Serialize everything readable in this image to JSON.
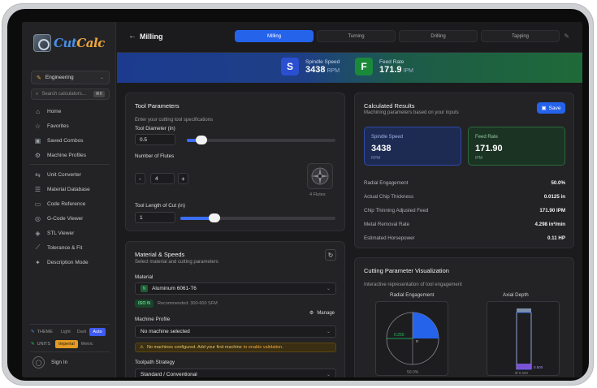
{
  "app": {
    "logo_cut": "Cut",
    "logo_calc": "Calc"
  },
  "sidebar": {
    "category": "Engineering",
    "search_placeholder": "Search calculators...",
    "search_shortcut": "⌘K",
    "items": [
      {
        "label": "Home",
        "icon": "home-icon",
        "glyph": "⌂"
      },
      {
        "label": "Favorites",
        "icon": "star-icon",
        "glyph": "☆"
      },
      {
        "label": "Saved Combos",
        "icon": "save-icon",
        "glyph": "▣"
      },
      {
        "label": "Machine Profiles",
        "icon": "gear-icon",
        "glyph": "⚙"
      },
      {
        "label": "Unit Converter",
        "icon": "swap-icon",
        "glyph": "⇆"
      },
      {
        "label": "Material Database",
        "icon": "database-icon",
        "glyph": "☰"
      },
      {
        "label": "Code Reference",
        "icon": "book-icon",
        "glyph": "▭"
      },
      {
        "label": "G-Code Viewer",
        "icon": "code-icon",
        "glyph": "◎"
      },
      {
        "label": "STL Viewer",
        "icon": "cube-icon",
        "glyph": "◈"
      },
      {
        "label": "Tolerance & Fit",
        "icon": "ruler-icon",
        "glyph": "⟋"
      },
      {
        "label": "Description Mode",
        "icon": "sparkle-icon",
        "glyph": "✦"
      }
    ],
    "theme_label": "THEME",
    "theme_options": [
      "Light",
      "Dark",
      "Auto"
    ],
    "theme_selected": "Auto",
    "units_label": "UNITS",
    "units_options": [
      "Imperial",
      "Metric"
    ],
    "units_selected": "Imperial",
    "signin": "Sign In"
  },
  "header": {
    "title": "Milling",
    "tabs": [
      "Milling",
      "Turning",
      "Drilling",
      "Tapping"
    ],
    "active_tab": "Milling"
  },
  "banner": {
    "spindle": {
      "letter": "S",
      "label": "Spindle Speed",
      "value": "3438",
      "unit": "RPM"
    },
    "feed": {
      "letter": "F",
      "label": "Feed Rate",
      "value": "171.9",
      "unit": "IPM"
    }
  },
  "tool": {
    "title": "Tool Parameters",
    "subtitle": "Enter your cutting tool specifications",
    "diameter_label": "Tool Diameter (in)",
    "diameter_value": "0.5",
    "diameter_slider": 0.1,
    "flutes_label": "Number of Flutes",
    "flutes_value": "4",
    "minus": "-",
    "plus": "+",
    "flutes_caption": "4 Flutes",
    "length_label": "Tool Length of Cut (in)",
    "length_value": "1",
    "length_slider": 0.22
  },
  "results": {
    "title": "Calculated Results",
    "subtitle": "Machining parameters based on your inputs",
    "save": "Save",
    "spindle": {
      "label": "Spindle Speed",
      "value": "3438",
      "unit": "RPM"
    },
    "feed": {
      "label": "Feed Rate",
      "value": "171.90",
      "unit": "IPM"
    },
    "rows": [
      {
        "label": "Radial Engagement",
        "value": "50.0%"
      },
      {
        "label": "Actual Chip Thickness",
        "value": "0.0125 in"
      },
      {
        "label": "Chip Thinning Adjusted Feed",
        "value": "171.90 IPM"
      },
      {
        "label": "Metal Removal Rate",
        "value": "4.298 in³/min"
      },
      {
        "label": "Estimated Horsepower",
        "value": "0.11 HP"
      }
    ]
  },
  "material": {
    "title": "Material & Speeds",
    "subtitle": "Select material and cutting parameters",
    "material_label": "Material",
    "material_badge": "N",
    "material_value": "Aluminum 6061-T6",
    "iso_tag": "ISO N",
    "recommended": "Recommended: 300-600 SFM",
    "machine_label": "Machine Profile",
    "manage": "Manage",
    "machine_value": "No machine selected",
    "warning": "No machines configured. Add your first machine",
    "warning_link": "to enable validation.",
    "strategy_label": "Toolpath Strategy",
    "strategy_value": "Standard / Conventional"
  },
  "viz": {
    "title": "Cutting Parameter Visualization",
    "subtitle": "Interactive representation of tool engagement",
    "radial_title": "Radial Engagement",
    "axial_title": "Axial Depth",
    "radial_inner": "0.250",
    "radial_center": "R",
    "radial_pct": "50.0%",
    "axial_depth": "0.500",
    "axial_dia": "Ø 0.500",
    "radial_fraction": 0.5,
    "colors": {
      "accent": "#2563eb",
      "engage": "#8b5cf6",
      "green": "#22c55e"
    }
  }
}
